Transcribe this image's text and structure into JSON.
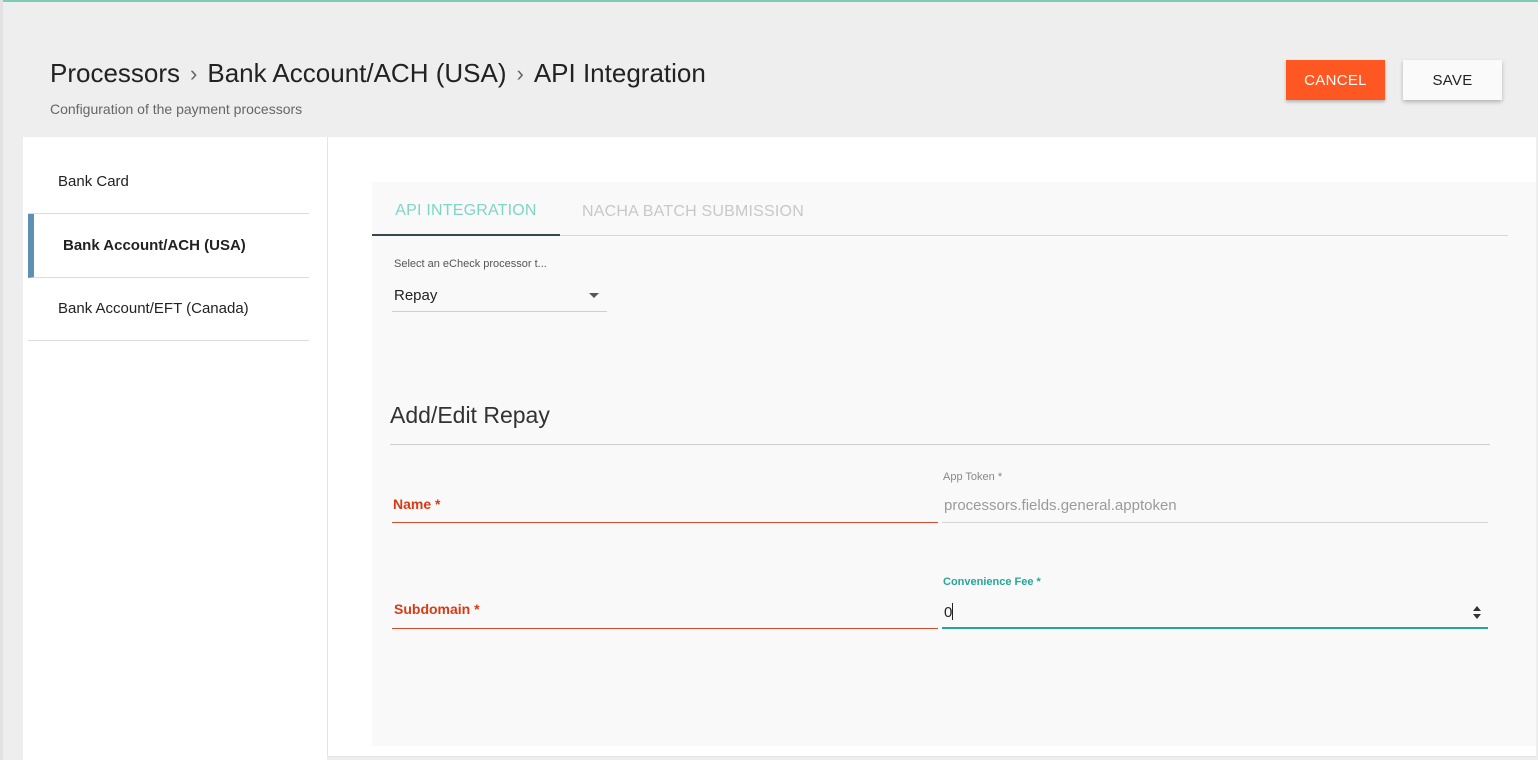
{
  "header": {
    "breadcrumb": [
      "Processors",
      "Bank Account/ACH (USA)",
      "API Integration"
    ],
    "subtitle": "Configuration of the payment processors"
  },
  "actions": {
    "cancel_label": "CANCEL",
    "save_label": "SAVE"
  },
  "sidebar": {
    "items": [
      {
        "label": "Bank Card",
        "active": false
      },
      {
        "label": "Bank Account/ACH (USA)",
        "active": true
      },
      {
        "label": "Bank Account/EFT (Canada)",
        "active": false
      }
    ]
  },
  "tabs": [
    {
      "label": "API INTEGRATION",
      "active": true
    },
    {
      "label": "NACHA BATCH SUBMISSION",
      "active": false
    }
  ],
  "processor_select": {
    "label": "Select an eCheck processor t...",
    "value": "Repay"
  },
  "form": {
    "title": "Add/Edit Repay",
    "name": {
      "label": "Name *",
      "value": ""
    },
    "app_token": {
      "label": "App Token *",
      "placeholder": "processors.fields.general.apptoken"
    },
    "subdomain": {
      "label": "Subdomain *",
      "value": ""
    },
    "convenience_fee": {
      "label": "Convenience Fee *",
      "value": "0"
    }
  },
  "colors": {
    "accent_teal": "#26a69a",
    "cancel_orange": "#ff5722",
    "error_red": "#d93a16",
    "active_sidebar_bar": "#5f8fb3"
  }
}
